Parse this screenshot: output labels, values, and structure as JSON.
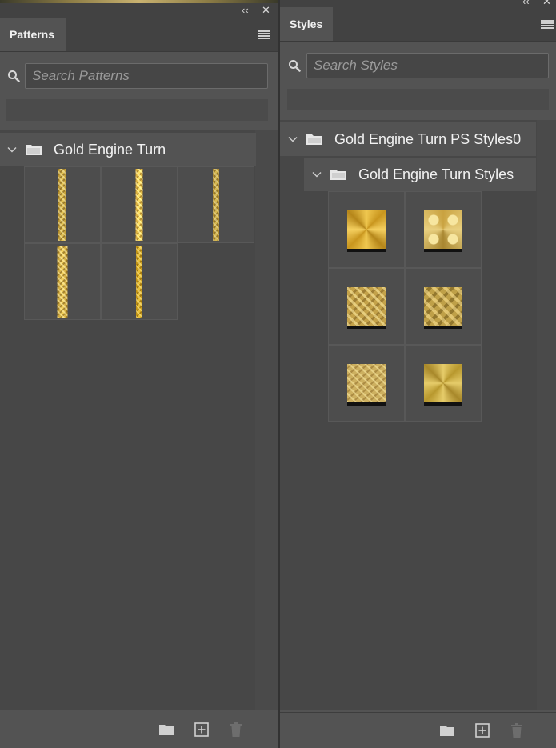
{
  "window_controls": {
    "collapse_label": "‹‹",
    "close_label": "✕"
  },
  "patterns_panel": {
    "tab_label": "Patterns",
    "search": {
      "placeholder": "Search Patterns",
      "value": ""
    },
    "groups": [
      {
        "label": "Gold Engine Turn",
        "expanded": true,
        "item_count": 5
      }
    ]
  },
  "styles_panel": {
    "tab_label": "Styles",
    "search": {
      "placeholder": "Search Styles",
      "value": ""
    },
    "groups": [
      {
        "label": "Gold Engine Turn PS Styles0",
        "expanded": true
      },
      {
        "label": "Gold Engine Turn Styles",
        "expanded": true,
        "item_count": 6
      }
    ]
  },
  "bottom_actions": [
    "folder-icon",
    "new-item-icon",
    "trash-icon"
  ],
  "colors": {
    "panel_bg": "#535353",
    "list_bg": "#474747",
    "gold": "#c9a43a"
  }
}
